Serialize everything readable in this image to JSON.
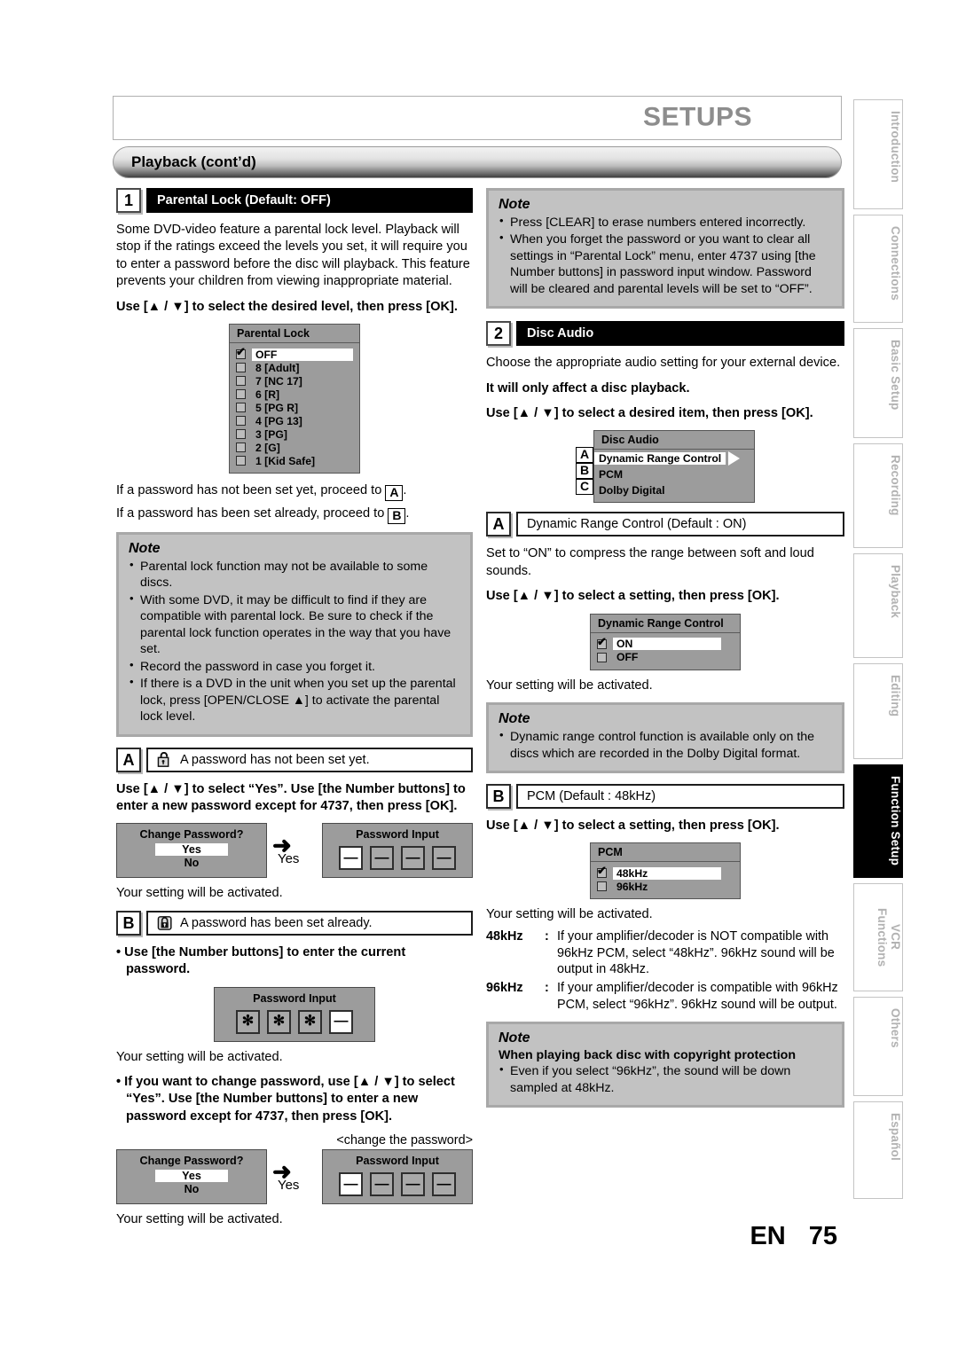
{
  "header": {
    "title": "SETUPS",
    "section": "Playback (cont’d)"
  },
  "footer": {
    "lang": "EN",
    "page": "75"
  },
  "side_tabs": [
    {
      "label": "Introduction",
      "active": false
    },
    {
      "label": "Connections",
      "active": false
    },
    {
      "label": "Basic Setup",
      "active": false
    },
    {
      "label": "Recording",
      "active": false
    },
    {
      "label": "Playback",
      "active": false
    },
    {
      "label": "Editing",
      "active": false
    },
    {
      "label": "Function Setup",
      "active": true
    },
    {
      "label": "VCR Functions",
      "active": false
    },
    {
      "label": "Others",
      "active": false
    },
    {
      "label": "Español",
      "active": false
    }
  ],
  "left": {
    "step1": {
      "number": "1",
      "title": "Parental Lock (Default: OFF)",
      "intro": "Some DVD-video feature a parental lock level. Playback will stop if the ratings exceed the levels you set, it will require you to enter a password before the disc will playback. This feature prevents your children from viewing inappropriate material.",
      "instruction": "Use [▲ / ▼] to select the desired level, then press [OK].",
      "menu": {
        "title": "Parental Lock",
        "items": [
          {
            "label": "OFF",
            "checked": true,
            "selected": true
          },
          {
            "label": "8 [Adult]",
            "checked": false,
            "selected": false
          },
          {
            "label": "7 [NC 17]",
            "checked": false,
            "selected": false
          },
          {
            "label": "6 [R]",
            "checked": false,
            "selected": false
          },
          {
            "label": "5 [PG R]",
            "checked": false,
            "selected": false
          },
          {
            "label": "4 [PG 13]",
            "checked": false,
            "selected": false
          },
          {
            "label": "3 [PG]",
            "checked": false,
            "selected": false
          },
          {
            "label": "2 [G]",
            "checked": false,
            "selected": false
          },
          {
            "label": "1 [Kid Safe]",
            "checked": false,
            "selected": false
          }
        ]
      },
      "proceed_a": "If a password has not been set yet, proceed to",
      "proceed_a_tag": "A",
      "proceed_a_end": ".",
      "proceed_b": "If a password has been set already, proceed to",
      "proceed_b_tag": "B",
      "proceed_b_end": "."
    },
    "note1": {
      "title": "Note",
      "items": [
        "Parental lock function may not be available to some discs.",
        "With some DVD, it may be difficult to find if they are compatible with parental lock. Be sure to check if the parental lock function operates in the way that you have set.",
        "Record the password in case you forget it.",
        "If there is a DVD in the unit when you set up the parental lock, press [OPEN/CLOSE ▲] to activate the parental lock level."
      ]
    },
    "sectionA": {
      "letter": "A",
      "icon": "unlocked-padlock-icon",
      "title": "A password has not been set yet.",
      "instruction": "Use [▲ / ▼] to select “Yes”. Use [the Number buttons] to enter a new password except for 4737, then press [OK].",
      "dialog1": {
        "title": "Change Password?",
        "yes": "Yes",
        "no": "No"
      },
      "arrow_label": "Yes",
      "dialog2": {
        "title": "Password Input",
        "cells": [
          "—",
          "—",
          "—",
          "—"
        ],
        "filled": [
          false,
          false,
          false,
          false
        ]
      },
      "result": "Your setting will be activated."
    },
    "sectionB": {
      "letter": "B",
      "icon": "locked-padlock-icon",
      "title": "A password has been set already.",
      "instruction": "Use [the Number buttons] to enter the current password.",
      "dialog": {
        "title": "Password Input",
        "cells": [
          "✻",
          "✻",
          "✻",
          "—"
        ],
        "filled": [
          false,
          false,
          false,
          true
        ]
      },
      "result": "Your setting will be activated.",
      "change_instruction": "If you want to change password, use [▲ / ▼] to select “Yes”. Use [the Number buttons] to enter a new password except for 4737, then press [OK].",
      "change_caption": "<change the password>",
      "dialog1": {
        "title": "Change Password?",
        "yes": "Yes",
        "no": "No"
      },
      "arrow_label": "Yes",
      "dialog2": {
        "title": "Password Input",
        "cells": [
          "—",
          "—",
          "—",
          "—"
        ]
      },
      "result2": "Your setting will be activated."
    }
  },
  "right": {
    "note_top": {
      "title": "Note",
      "items": [
        "Press [CLEAR] to erase numbers entered incorrectly.",
        "When you forget the password or you want to clear all settings in “Parental Lock” menu, enter 4737 using [the Number buttons] in password input window. Password will be cleared and parental levels will be set to “OFF”."
      ]
    },
    "step2": {
      "number": "2",
      "title": "Disc Audio",
      "intro": "Choose the appropriate audio setting for your external device.",
      "bold_note": "It will only affect a disc playback.",
      "instruction": "Use [▲ / ▼] to select a desired item, then press [OK].",
      "menu": {
        "title": "Disc Audio",
        "items": [
          {
            "badge": "A",
            "label": "Dynamic Range Control",
            "selected": true
          },
          {
            "badge": "B",
            "label": "PCM",
            "selected": false
          },
          {
            "badge": "C",
            "label": "Dolby Digital",
            "selected": false
          }
        ]
      }
    },
    "sectionA": {
      "letter": "A",
      "title": "Dynamic Range Control (Default : ON)",
      "intro": "Set to “ON” to compress the range between soft and loud sounds.",
      "instruction": "Use [▲ / ▼] to select a setting, then press [OK].",
      "menu": {
        "title": "Dynamic Range Control",
        "items": [
          {
            "label": "ON",
            "checked": true,
            "selected": true
          },
          {
            "label": "OFF",
            "checked": false,
            "selected": false
          }
        ]
      },
      "result": "Your setting will be activated."
    },
    "note_drc": {
      "title": "Note",
      "items": [
        "Dynamic range control function is available only on the discs which are recorded in the Dolby Digital format."
      ]
    },
    "sectionB": {
      "letter": "B",
      "title": "PCM (Default : 48kHz)",
      "instruction": "Use [▲ / ▼] to select a setting, then press [OK].",
      "menu": {
        "title": "PCM",
        "items": [
          {
            "label": "48kHz",
            "checked": true,
            "selected": true
          },
          {
            "label": "96kHz",
            "checked": false,
            "selected": false
          }
        ]
      },
      "result": "Your setting will be activated.",
      "definitions": [
        {
          "term": "48kHz",
          "colon": ":",
          "desc": "If your amplifier/decoder is NOT compatible with 96kHz PCM, select “48kHz”. 96kHz sound will be output in 48kHz."
        },
        {
          "term": "96kHz",
          "colon": ":",
          "desc": "If your amplifier/decoder is compatible with 96kHz PCM, select “96kHz”. 96kHz sound will be output."
        }
      ]
    },
    "note_bottom": {
      "title": "Note",
      "subtitle": "When playing back disc with copyright protection",
      "items": [
        "Even if you select “96kHz”, the sound will be down sampled at 48kHz."
      ]
    }
  }
}
